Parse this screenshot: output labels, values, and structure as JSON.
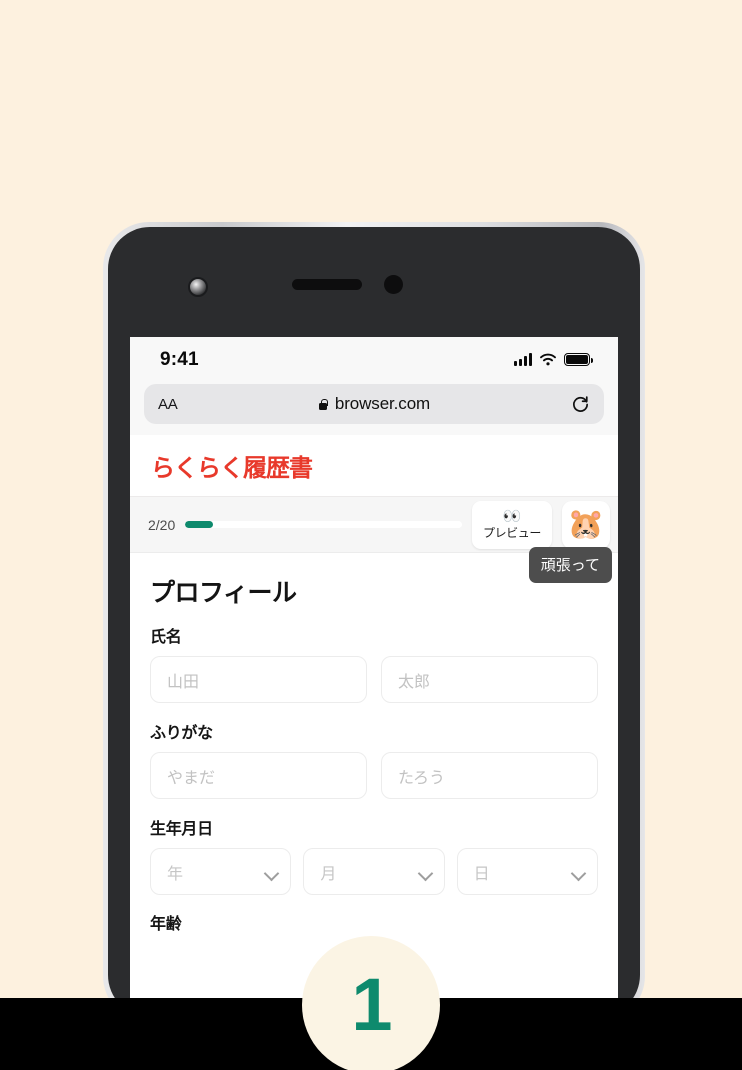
{
  "page": {
    "background_color": "#FDF1DF",
    "bottom_band_color": "#000000"
  },
  "step_badge": {
    "number": "1",
    "circle_color": "#FBF4E4",
    "number_color": "#0e8a6d"
  },
  "phone": {
    "status_bar": {
      "time": "9:41",
      "signal_icon": "cellular-signal-icon",
      "wifi_icon": "wifi-icon",
      "battery_icon": "battery-full-icon"
    },
    "browser": {
      "text_size_button": "AA",
      "lock_icon": "lock-icon",
      "url": "browser.com",
      "reload_icon": "reload-icon"
    }
  },
  "site": {
    "logo_text": "らくらく履歴書",
    "logo_color": "#e8392b"
  },
  "progress": {
    "count_label": "2/20",
    "current": 2,
    "total": 20,
    "percent": 10,
    "fill_color": "#0e8a6d",
    "preview_button": {
      "icon": "👀",
      "icon_name": "eyes-icon",
      "label": "プレビュー"
    },
    "mascot_button": {
      "emoji": "🐹",
      "icon_name": "hamster-mascot-icon"
    },
    "mascot_tooltip": "頑張って"
  },
  "form": {
    "section_title": "プロフィール",
    "fields": [
      {
        "label": "氏名",
        "type": "text-pair",
        "inputs": [
          {
            "name": "last-name",
            "value": "",
            "placeholder": "山田"
          },
          {
            "name": "first-name",
            "value": "",
            "placeholder": "太郎"
          }
        ]
      },
      {
        "label": "ふりがな",
        "type": "text-pair",
        "inputs": [
          {
            "name": "last-name-kana",
            "value": "",
            "placeholder": "やまだ"
          },
          {
            "name": "first-name-kana",
            "value": "",
            "placeholder": "たろう"
          }
        ]
      },
      {
        "label": "生年月日",
        "type": "select-triple",
        "selects": [
          {
            "name": "birth-year",
            "value": "年"
          },
          {
            "name": "birth-month",
            "value": "月"
          },
          {
            "name": "birth-day",
            "value": "日"
          }
        ]
      },
      {
        "label": "年齢",
        "type": "text",
        "inputs": []
      }
    ]
  }
}
